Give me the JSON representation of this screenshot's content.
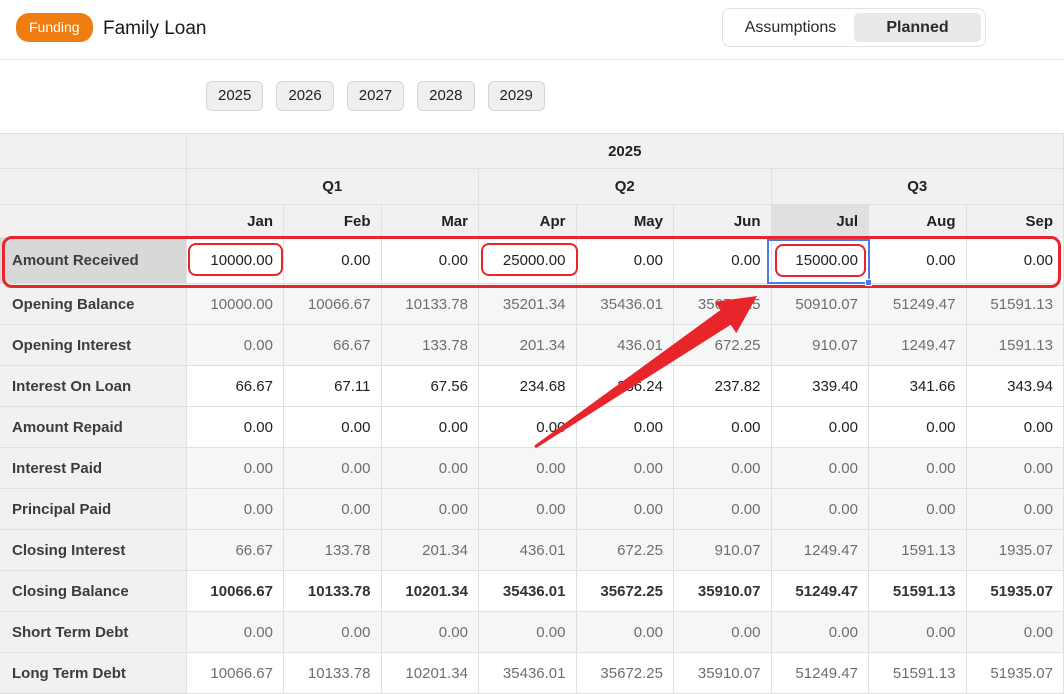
{
  "header": {
    "badge": "Funding",
    "title": "Family Loan",
    "view_toggle": {
      "options": [
        "Assumptions",
        "Planned"
      ],
      "selected": "Planned"
    }
  },
  "year_tabs": [
    "2025",
    "2026",
    "2027",
    "2028",
    "2029"
  ],
  "table": {
    "year_header": "2025",
    "quarters": [
      "Q1",
      "Q2",
      "Q3"
    ],
    "months": [
      "Jan",
      "Feb",
      "Mar",
      "Apr",
      "May",
      "Jun",
      "Jul",
      "Aug",
      "Sep"
    ],
    "selected_month": "Jul",
    "selected_row": "Amount Received",
    "rows": [
      {
        "label": "Amount Received",
        "style": "input",
        "values": [
          "10000.00",
          "0.00",
          "0.00",
          "25000.00",
          "0.00",
          "0.00",
          "15000.00",
          "0.00",
          "0.00"
        ]
      },
      {
        "label": "Opening Balance",
        "style": "computed",
        "values": [
          "10000.00",
          "10066.67",
          "10133.78",
          "35201.34",
          "35436.01",
          "35672.25",
          "50910.07",
          "51249.47",
          "51591.13"
        ]
      },
      {
        "label": "Opening Interest",
        "style": "computed",
        "values": [
          "0.00",
          "66.67",
          "133.78",
          "201.34",
          "436.01",
          "672.25",
          "910.07",
          "1249.47",
          "1591.13"
        ]
      },
      {
        "label": "Interest On Loan",
        "style": "input",
        "values": [
          "66.67",
          "67.11",
          "67.56",
          "234.68",
          "236.24",
          "237.82",
          "339.40",
          "341.66",
          "343.94"
        ]
      },
      {
        "label": "Amount Repaid",
        "style": "input",
        "values": [
          "0.00",
          "0.00",
          "0.00",
          "0.00",
          "0.00",
          "0.00",
          "0.00",
          "0.00",
          "0.00"
        ]
      },
      {
        "label": "Interest Paid",
        "style": "computed",
        "values": [
          "0.00",
          "0.00",
          "0.00",
          "0.00",
          "0.00",
          "0.00",
          "0.00",
          "0.00",
          "0.00"
        ]
      },
      {
        "label": "Principal Paid",
        "style": "computed",
        "values": [
          "0.00",
          "0.00",
          "0.00",
          "0.00",
          "0.00",
          "0.00",
          "0.00",
          "0.00",
          "0.00"
        ]
      },
      {
        "label": "Closing Interest",
        "style": "computed",
        "values": [
          "66.67",
          "133.78",
          "201.34",
          "436.01",
          "672.25",
          "910.07",
          "1249.47",
          "1591.13",
          "1935.07"
        ]
      },
      {
        "label": "Closing Balance",
        "style": "total",
        "values": [
          "10066.67",
          "10133.78",
          "10201.34",
          "35436.01",
          "35672.25",
          "35910.07",
          "51249.47",
          "51591.13",
          "51935.07"
        ]
      },
      {
        "label": "Short Term Debt",
        "style": "computed",
        "values": [
          "0.00",
          "0.00",
          "0.00",
          "0.00",
          "0.00",
          "0.00",
          "0.00",
          "0.00",
          "0.00"
        ]
      },
      {
        "label": "Long Term Debt",
        "style": "computed-white",
        "values": [
          "10066.67",
          "10133.78",
          "10201.34",
          "35436.01",
          "35672.25",
          "35910.07",
          "51249.47",
          "51591.13",
          "51935.07"
        ]
      }
    ]
  },
  "annotations": {
    "highlighted_cells": [
      {
        "row": "Amount Received",
        "month": "Jan",
        "value": "10000.00"
      },
      {
        "row": "Amount Received",
        "month": "Apr",
        "value": "25000.00"
      },
      {
        "row": "Amount Received",
        "month": "Jul",
        "value": "15000.00"
      }
    ],
    "highlighted_row": "Amount Received",
    "selected_cell": {
      "row": "Amount Received",
      "month": "Jul",
      "value": "15000.00"
    },
    "arrow_target": "Jul Amount Received cell",
    "colors": {
      "annotation_red": "#e8252b",
      "selection_blue": "#4a7de2",
      "badge_orange": "#ef7d12"
    }
  }
}
